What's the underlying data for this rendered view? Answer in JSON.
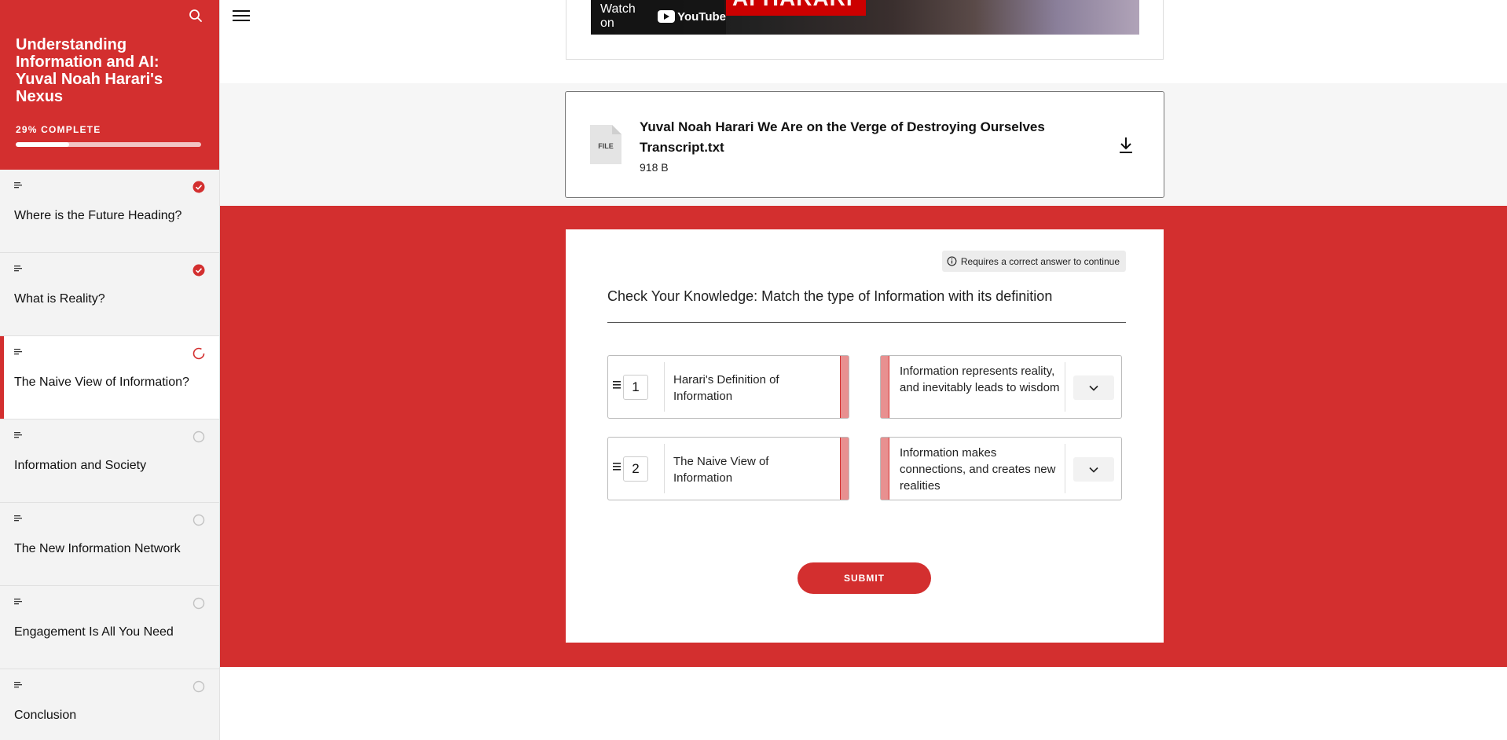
{
  "sidebar": {
    "course_title": "Understanding Information and AI: Yuval Noah Harari's Nexus",
    "progress_label": "29% COMPLETE",
    "progress_value": 0.29,
    "accent_color": "#d32f2f",
    "items": [
      {
        "label": "Where is the Future Heading?",
        "status": "complete"
      },
      {
        "label": "What is Reality?",
        "status": "complete"
      },
      {
        "label": "The Naive View of Information?",
        "status": "in-progress"
      },
      {
        "label": "Information and Society",
        "status": "not-started"
      },
      {
        "label": "The New Information Network",
        "status": "not-started"
      },
      {
        "label": "Engagement Is All You Need",
        "status": "not-started"
      },
      {
        "label": "Conclusion",
        "status": "not-started"
      }
    ]
  },
  "video": {
    "watch_on": "Watch on",
    "platform": "YouTube",
    "overlay_text": "AI HARARI"
  },
  "file": {
    "icon_label": "FILE",
    "title": "Yuval Noah Harari We Are on the Verge of Destroying Ourselves Transcript.txt",
    "size": "918 B"
  },
  "quiz": {
    "requirement": "Requires a correct answer to continue",
    "question": "Check Your Knowledge: Match the type of Information with its definition",
    "left_items": [
      {
        "number": "1",
        "text": "Harari's Definition of Information"
      },
      {
        "number": "2",
        "text": "The Naive View of Information"
      }
    ],
    "right_items": [
      {
        "text": "Information represents reality, and inevitably leads to wisdom"
      },
      {
        "text": "Information makes connections, and creates new realities"
      }
    ],
    "submit_label": "SUBMIT"
  }
}
